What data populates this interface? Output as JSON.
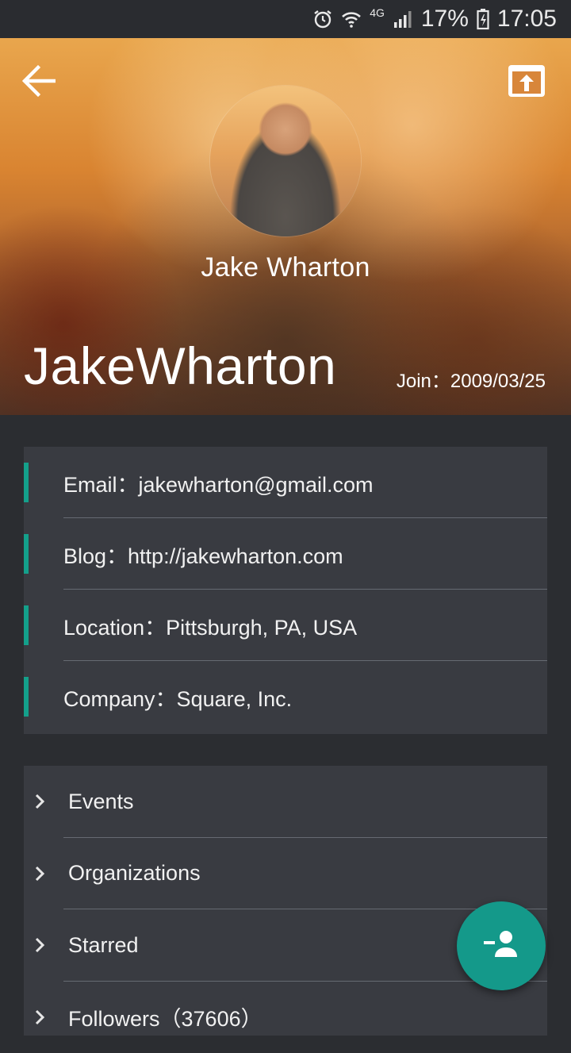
{
  "status_bar": {
    "battery": "17%",
    "time": "17:05",
    "network": "4G",
    "icons": [
      "alarm-icon",
      "wifi-icon",
      "signal-icon",
      "battery-icon"
    ]
  },
  "header": {
    "back_icon": "arrow-back-icon",
    "share_icon": "open-in-browser-icon",
    "display_name": "Jake Wharton",
    "login": "JakeWharton",
    "join": "Join：2009/03/25"
  },
  "info": {
    "accent_color": "#14a08b",
    "rows": [
      {
        "label": "Email：jakewharton@gmail.com"
      },
      {
        "label": "Blog：http://jakewharton.com"
      },
      {
        "label": "Location：Pittsburgh, PA, USA"
      },
      {
        "label": "Company：Square, Inc."
      }
    ]
  },
  "menu": {
    "chevron_icon": "chevron-right-icon",
    "items": [
      {
        "label": "Events"
      },
      {
        "label": "Organizations"
      },
      {
        "label": "Starred"
      },
      {
        "label": "Followers（37606）"
      }
    ]
  },
  "fab": {
    "icon": "person-remove-icon",
    "color": "#14998a"
  }
}
